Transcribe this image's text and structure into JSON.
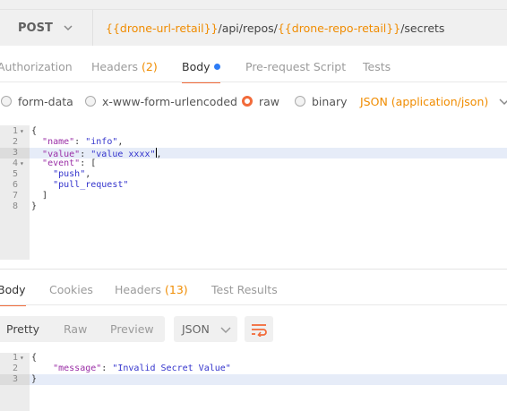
{
  "request": {
    "method": "POST",
    "url_parts": [
      {
        "text": "{{drone-url-retail}}",
        "var": true
      },
      {
        "text": "/api/repos/",
        "var": false
      },
      {
        "text": "{{drone-repo-retail}}",
        "var": true
      },
      {
        "text": "/secrets",
        "var": false
      }
    ],
    "tabs": {
      "authorization": "Authorization",
      "headers": "Headers",
      "headers_count": "(2)",
      "body": "Body",
      "prerequest": "Pre-request Script",
      "tests": "Tests"
    },
    "body_types": {
      "form_data": "form-data",
      "urlencoded": "x-www-form-urlencoded",
      "raw": "raw",
      "binary": "binary",
      "selected": "raw"
    },
    "content_type": "JSON (application/json)",
    "code_lines": [
      {
        "n": "1",
        "fold": true,
        "text": "{"
      },
      {
        "n": "2",
        "fold": false,
        "text": "  \"name\": \"info\","
      },
      {
        "n": "3",
        "fold": false,
        "text": "  \"value\": \"value xxxx\","
      },
      {
        "n": "4",
        "fold": true,
        "text": "  \"event\": ["
      },
      {
        "n": "5",
        "fold": false,
        "text": "    \"push\","
      },
      {
        "n": "6",
        "fold": false,
        "text": "    \"pull_request\""
      },
      {
        "n": "7",
        "fold": false,
        "text": "  ]"
      },
      {
        "n": "8",
        "fold": false,
        "text": "}"
      }
    ],
    "highlighted_line": 3
  },
  "response": {
    "tabs": {
      "body": "Body",
      "cookies": "Cookies",
      "headers": "Headers",
      "headers_count": "(13)",
      "test_results": "Test Results"
    },
    "view_modes": {
      "pretty": "Pretty",
      "raw": "Raw",
      "preview": "Preview",
      "selected": "Pretty"
    },
    "format": "JSON",
    "code_lines": [
      {
        "n": "1",
        "fold": true,
        "text": "{"
      },
      {
        "n": "2",
        "fold": false,
        "text": "    \"message\": \"Invalid Secret Value\""
      },
      {
        "n": "3",
        "fold": false,
        "text": "}"
      }
    ],
    "highlighted_line": 3
  },
  "colors": {
    "accent": "#f26b3a",
    "variable": "#f08c00",
    "json_key": "#9a2ea6",
    "json_string": "#3333cc",
    "active_dot": "#2d7cf6"
  }
}
